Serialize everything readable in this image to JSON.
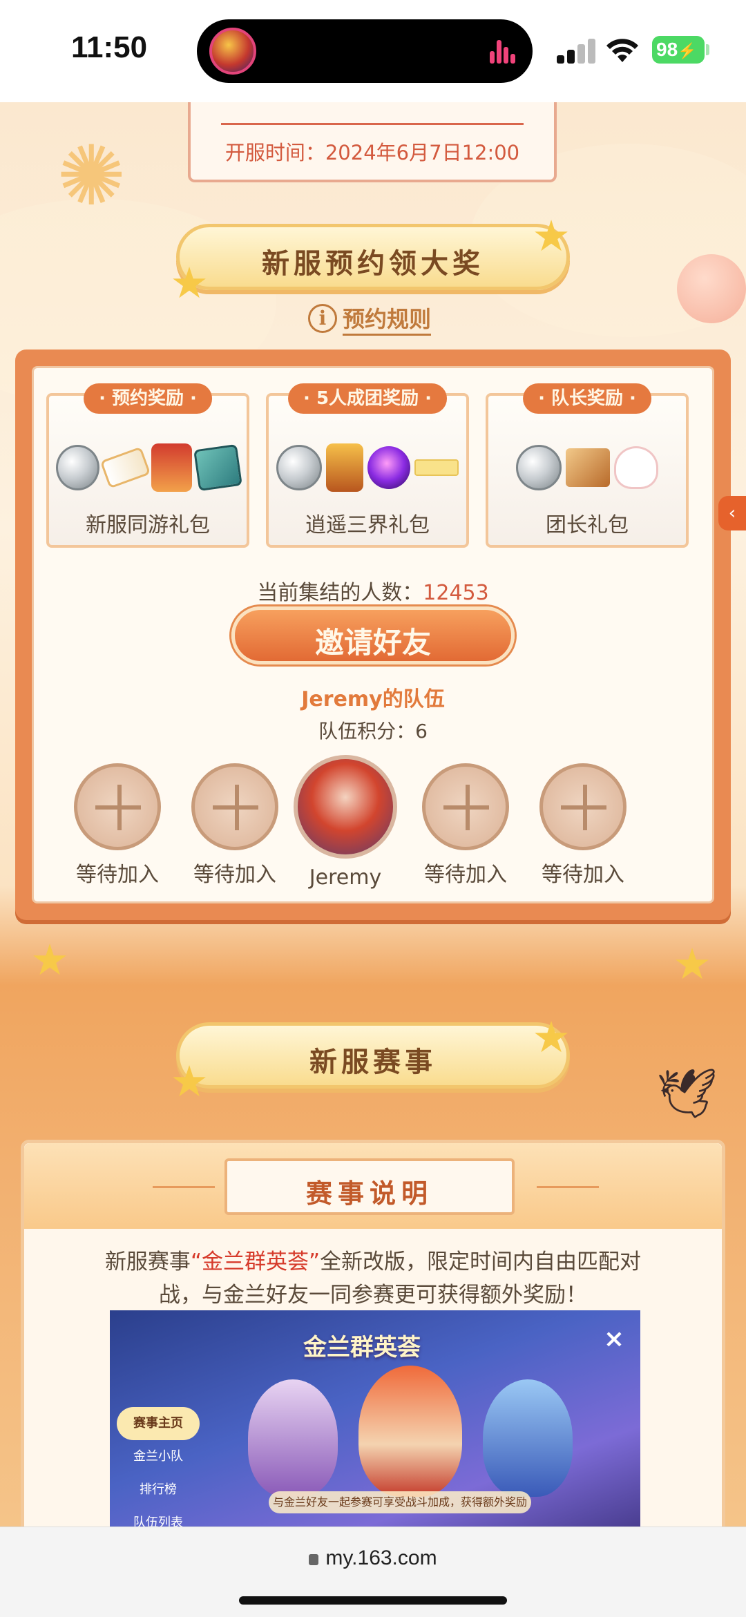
{
  "status_bar": {
    "time": "11:50",
    "battery": "98"
  },
  "top_plaque": {
    "open_time": "开服时间：2024年6月7日12:00"
  },
  "reservation": {
    "title": "新服预约领大奖",
    "rules_label": "预约规则",
    "rewards": [
      {
        "tag": "· 预约奖励 ·",
        "name": "新服同游礼包"
      },
      {
        "tag": "· 5人成团奖励 ·",
        "name": "逍遥三界礼包"
      },
      {
        "tag": "· 队长奖励 ·",
        "name": "团长礼包"
      }
    ],
    "count_label": "当前集结的人数：",
    "count_value": "12453",
    "invite_button": "邀请好友",
    "team_name": "Jeremy的队伍",
    "team_score": "队伍积分：6",
    "members": [
      {
        "label": "等待加入"
      },
      {
        "label": "等待加入"
      },
      {
        "label": "Jeremy"
      },
      {
        "label": "等待加入"
      },
      {
        "label": "等待加入"
      }
    ]
  },
  "events": {
    "title": "新服赛事",
    "tab_label": "赛事说明",
    "desc_pre": "新服赛事",
    "desc_highlight": "“金兰群英荟”",
    "desc_post": "全新改版，限定时间内自由匹配对战，与金兰好友一同参赛更可获得额外奖励！",
    "screenshot": {
      "title": "金兰群英荟",
      "side_menu": [
        "赛事主页",
        "金兰小队",
        "排行榜",
        "队伍列表"
      ],
      "banner": "与金兰好友一起参赛可享受战斗加成，获得额外奖励",
      "close": "×"
    }
  },
  "browser": {
    "url": "my.163.com"
  }
}
